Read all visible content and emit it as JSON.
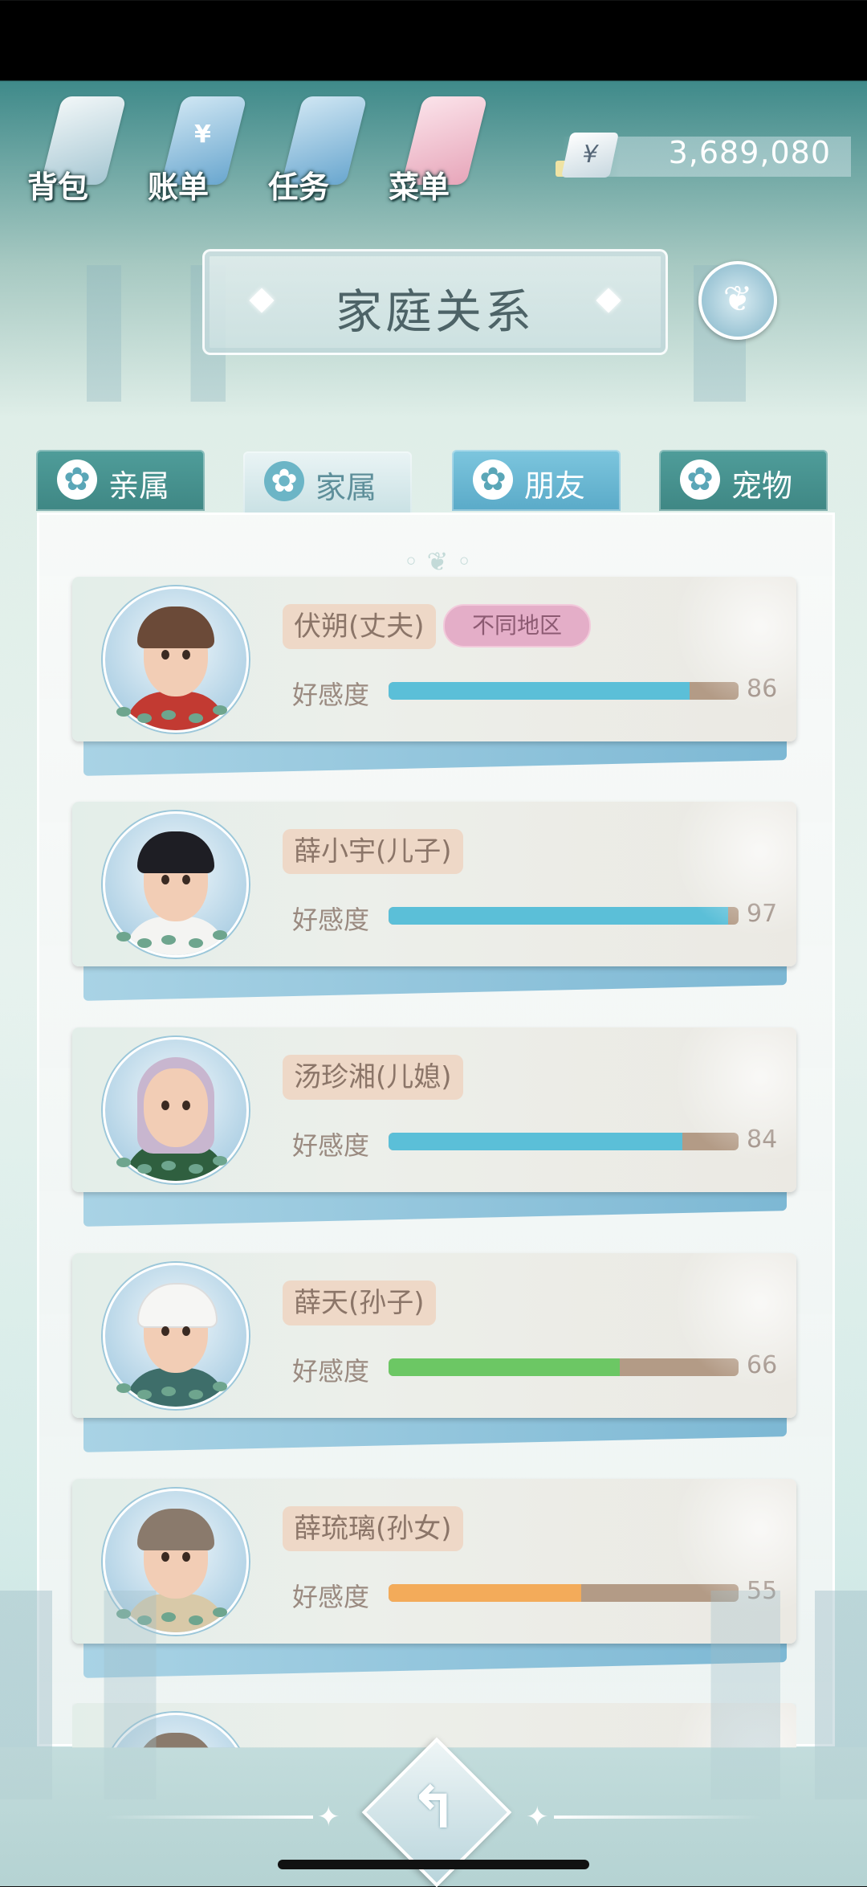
{
  "top_menu": [
    {
      "label": "背包",
      "icon": "bag-icon"
    },
    {
      "label": "账单",
      "icon": "bill-icon",
      "glyph": "¥"
    },
    {
      "label": "任务",
      "icon": "task-icon"
    },
    {
      "label": "菜单",
      "icon": "menu-icon"
    }
  ],
  "currency": {
    "symbol": "¥",
    "amount": "3,689,080"
  },
  "header": {
    "title": "家庭关系",
    "family_tree_icon": "family-tree-icon"
  },
  "tabs": [
    {
      "label": "亲属",
      "icon": "flower-icon",
      "active": false
    },
    {
      "label": "家属",
      "icon": "flower-icon",
      "active": true
    },
    {
      "label": "朋友",
      "icon": "flower-icon",
      "active": false
    },
    {
      "label": "宠物",
      "icon": "flower-icon",
      "active": false
    }
  ],
  "favor_label": "好感度",
  "members": [
    {
      "name": "伏朔(丈夫)",
      "region_badge": "不同地区",
      "favor": 86,
      "bar_color": "#5bbfd8"
    },
    {
      "name": "薛小宇(儿子)",
      "favor": 97,
      "bar_color": "#5bbfd8"
    },
    {
      "name": "汤珍湘(儿媳)",
      "favor": 84,
      "bar_color": "#5bbfd8"
    },
    {
      "name": "薛天(孙子)",
      "favor": 66,
      "bar_color": "#6cc764"
    },
    {
      "name": "薛琉璃(孙女)",
      "favor": 55,
      "bar_color": "#f3ab5a"
    }
  ],
  "colors": {
    "accent_teal": "#4f9d9a",
    "bar_track": "#b39b86"
  },
  "back_button": {
    "glyph": "↰",
    "icon": "back-icon"
  }
}
